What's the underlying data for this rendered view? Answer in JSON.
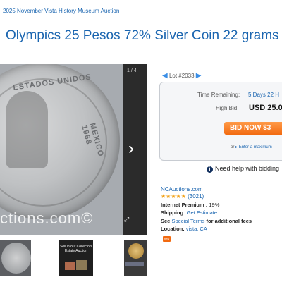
{
  "breadcrumb": "2025 November Vista History Museum Auction",
  "title": "Olympics 25 Pesos 72% Silver Coin 22 grams",
  "gallery": {
    "counter": "1 / 4",
    "watermark": "ctions.com©",
    "coin_text_top": "ESTADOS UNIDOS",
    "coin_text_side": "MEXICO 1968"
  },
  "thumbnails": {
    "estate_text": "Sell in our Collectors Estate Auction"
  },
  "lot": {
    "label": "Lot #2033"
  },
  "bid": {
    "time_label": "Time Remaining:",
    "time_value": "5 Days 22 H",
    "high_bid_label": "High Bid:",
    "high_bid_value": "USD 25.0",
    "button_label": "BID NOW $3",
    "or_text": "or",
    "max_link": "Enter a maximum"
  },
  "help": {
    "text": "Need help with bidding"
  },
  "seller": {
    "name": "NCAuctions.com",
    "stars": "★★★★★",
    "rating_count": "(3021)",
    "premium_label": "Internet Premium :",
    "premium_value": "19%",
    "shipping_label": "Shipping:",
    "shipping_value": "Get Estimate",
    "terms_see": "See",
    "terms_link": "Special Terms",
    "terms_suffix": "for additional fees",
    "location_label": "Location:",
    "location_value": "vista, CA",
    "badge": "new"
  }
}
